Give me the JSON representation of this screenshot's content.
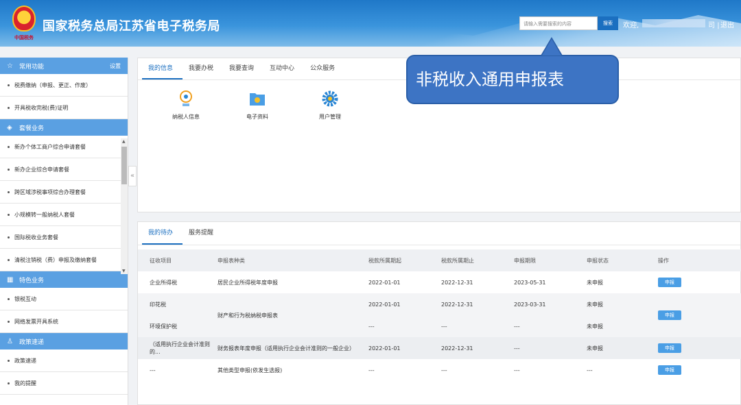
{
  "header": {
    "emblem_text": "中国税务",
    "site_title": "国家税务总局江苏省电子税务局",
    "search_placeholder": "请输入需要搜索的内容",
    "search_button": "搜索",
    "welcome": "欢迎,",
    "user_tail": "司",
    "separator": "|",
    "logout": "退出",
    "colors": {
      "header": "#2a86d4",
      "accent": "#1b6fc0"
    }
  },
  "sidebar": {
    "sections": [
      {
        "title": "常用功能",
        "icon": "star-icon",
        "action": "设置",
        "items": [
          "税费缴纳（申报、更正、作废）",
          "开具税收完税(费)证明"
        ]
      },
      {
        "title": "套餐业务",
        "icon": "cube-icon",
        "action": "",
        "items": [
          "新办个体工商户综合申请套餐",
          "新办企业综合申请套餐",
          "跨区域涉税事项综合办理套餐",
          "小规模转一般纳税人套餐",
          "国际税收业务套餐",
          "清税注销税（费）申报及缴纳套餐"
        ]
      },
      {
        "title": "特色业务",
        "icon": "grid-icon",
        "action": "",
        "items": [
          "银税互动",
          "网络发票开具系统"
        ]
      },
      {
        "title": "政策速递",
        "icon": "person-icon",
        "action": "",
        "items": [
          "政策速递",
          "我的提醒"
        ]
      }
    ],
    "collapse_glyph": "«"
  },
  "info_panel": {
    "tabs": [
      "我的信息",
      "我要办税",
      "我要查询",
      "互动中心",
      "公众服务"
    ],
    "active_tab": 0,
    "quick_links": [
      {
        "label": "纳税人信息",
        "icon": "taxpayer-info-icon"
      },
      {
        "label": "电子资料",
        "icon": "folder-icon"
      },
      {
        "label": "用户管理",
        "icon": "gear-icon"
      }
    ]
  },
  "todo_panel": {
    "tabs": [
      "我的待办",
      "服务提醒"
    ],
    "active_tab": 0,
    "columns": [
      "征收项目",
      "申报表种类",
      "税款所属期起",
      "税款所属期止",
      "申报期限",
      "申报状态",
      "操作"
    ],
    "rows": [
      {
        "item": "企业所得税",
        "form": "居民企业所得税年度申报",
        "start": "2022-01-01",
        "end": "2022-12-31",
        "deadline": "2023-05-31",
        "status": "未申报",
        "action": "申报"
      },
      {
        "item": "印花税",
        "form": "财产和行为税纳税申报表",
        "start": "2022-01-01",
        "end": "2022-12-31",
        "deadline": "2023-03-31",
        "status": "未申报",
        "action": "申报"
      },
      {
        "item": "环境保护税",
        "form": "",
        "start": "---",
        "end": "---",
        "deadline": "---",
        "status": "未申报",
        "action": ""
      },
      {
        "item": "（适用执行企业会计准则的...",
        "form": "财务报表年度申报（适用执行企业会计准则的一般企业）",
        "start": "2022-01-01",
        "end": "2022-12-31",
        "deadline": "---",
        "status": "未申报",
        "action": "申报"
      },
      {
        "item": "---",
        "form": "其他类型申报(依发生选报)",
        "start": "---",
        "end": "---",
        "deadline": "---",
        "status": "---",
        "action": "申报"
      }
    ]
  },
  "callout": {
    "text": "非税收入通用申报表",
    "color": "#3d74c4"
  }
}
